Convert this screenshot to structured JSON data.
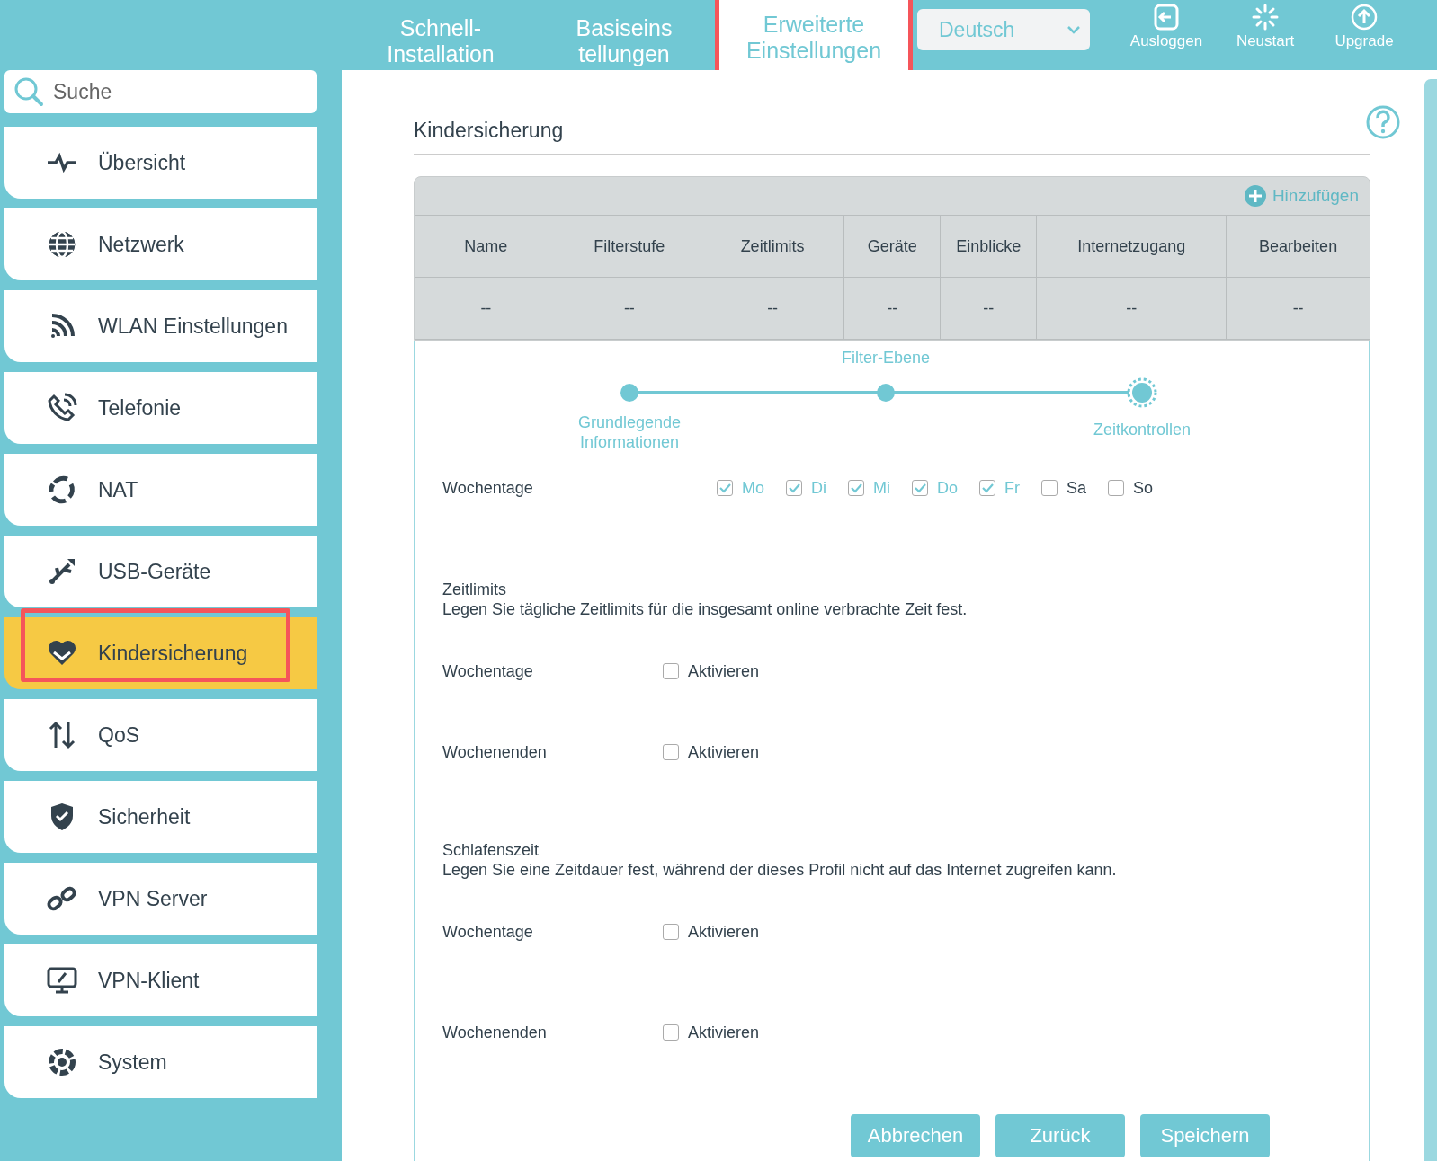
{
  "top_nav": {
    "tabs": [
      {
        "label": "Schnell-\nInstallation",
        "selected": false,
        "highlighted": false
      },
      {
        "label": "Basiseins\ntellungen",
        "selected": false,
        "highlighted": false
      },
      {
        "label": "Erweiterte\nEinstellungen",
        "selected": true,
        "highlighted": true
      }
    ],
    "language": "Deutsch",
    "actions": [
      {
        "label": "Ausloggen"
      },
      {
        "label": "Neustart"
      },
      {
        "label": "Upgrade"
      }
    ]
  },
  "sidebar": {
    "search": {
      "placeholder": "Suche"
    },
    "items": [
      {
        "label": "Übersicht",
        "selected": false,
        "highlighted": false
      },
      {
        "label": "Netzwerk",
        "selected": false,
        "highlighted": false
      },
      {
        "label": "WLAN Einstellungen",
        "selected": false,
        "highlighted": false
      },
      {
        "label": "Telefonie",
        "selected": false,
        "highlighted": false
      },
      {
        "label": "NAT",
        "selected": false,
        "highlighted": false
      },
      {
        "label": "USB-Geräte",
        "selected": false,
        "highlighted": false
      },
      {
        "label": "Kindersicherung",
        "selected": true,
        "highlighted": true
      },
      {
        "label": "QoS",
        "selected": false,
        "highlighted": false
      },
      {
        "label": "Sicherheit",
        "selected": false,
        "highlighted": false
      },
      {
        "label": "VPN Server",
        "selected": false,
        "highlighted": false
      },
      {
        "label": "VPN-Klient",
        "selected": false,
        "highlighted": false
      },
      {
        "label": "System",
        "selected": false,
        "highlighted": false
      }
    ]
  },
  "content": {
    "title": "Kindersicherung",
    "add_button": "Hinzufügen",
    "table": {
      "columns": [
        "Name",
        "Filterstufe",
        "Zeitlimits",
        "Geräte",
        "Einblicke",
        "Internetzugang",
        "Bearbeiten"
      ],
      "rows": [
        [
          "--",
          "--",
          "--",
          "--",
          "--",
          "--",
          "--"
        ]
      ]
    },
    "stepper": [
      {
        "label": "Grundlegende\nInformationen",
        "current": false
      },
      {
        "label": "Filter-Ebene",
        "current": false
      },
      {
        "label": "Zeitkontrollen",
        "current": true
      }
    ],
    "weekdays": {
      "label": "Wochentage",
      "days": [
        {
          "label": "Mo",
          "checked": true
        },
        {
          "label": "Di",
          "checked": true
        },
        {
          "label": "Mi",
          "checked": true
        },
        {
          "label": "Do",
          "checked": true
        },
        {
          "label": "Fr",
          "checked": true
        },
        {
          "label": "Sa",
          "checked": false
        },
        {
          "label": "So",
          "checked": false
        }
      ]
    },
    "sections": [
      {
        "title": "Zeitlimits",
        "description": "Legen Sie tägliche Zeitlimits für die insgesamt online verbrachte Zeit fest.",
        "rows": [
          {
            "label": "Wochentage",
            "option": "Aktivieren",
            "checked": false
          },
          {
            "label": "Wochenenden",
            "option": "Aktivieren",
            "checked": false
          }
        ]
      },
      {
        "title": "Schlafenszeit",
        "description": "Legen Sie eine Zeitdauer fest, während der dieses Profil nicht auf das Internet zugreifen kann.",
        "rows": [
          {
            "label": "Wochentage",
            "option": "Aktivieren",
            "checked": false
          },
          {
            "label": "Wochenenden",
            "option": "Aktivieren",
            "checked": false
          }
        ]
      }
    ],
    "buttons": [
      "Abbrechen",
      "Zurück",
      "Speichern"
    ]
  }
}
